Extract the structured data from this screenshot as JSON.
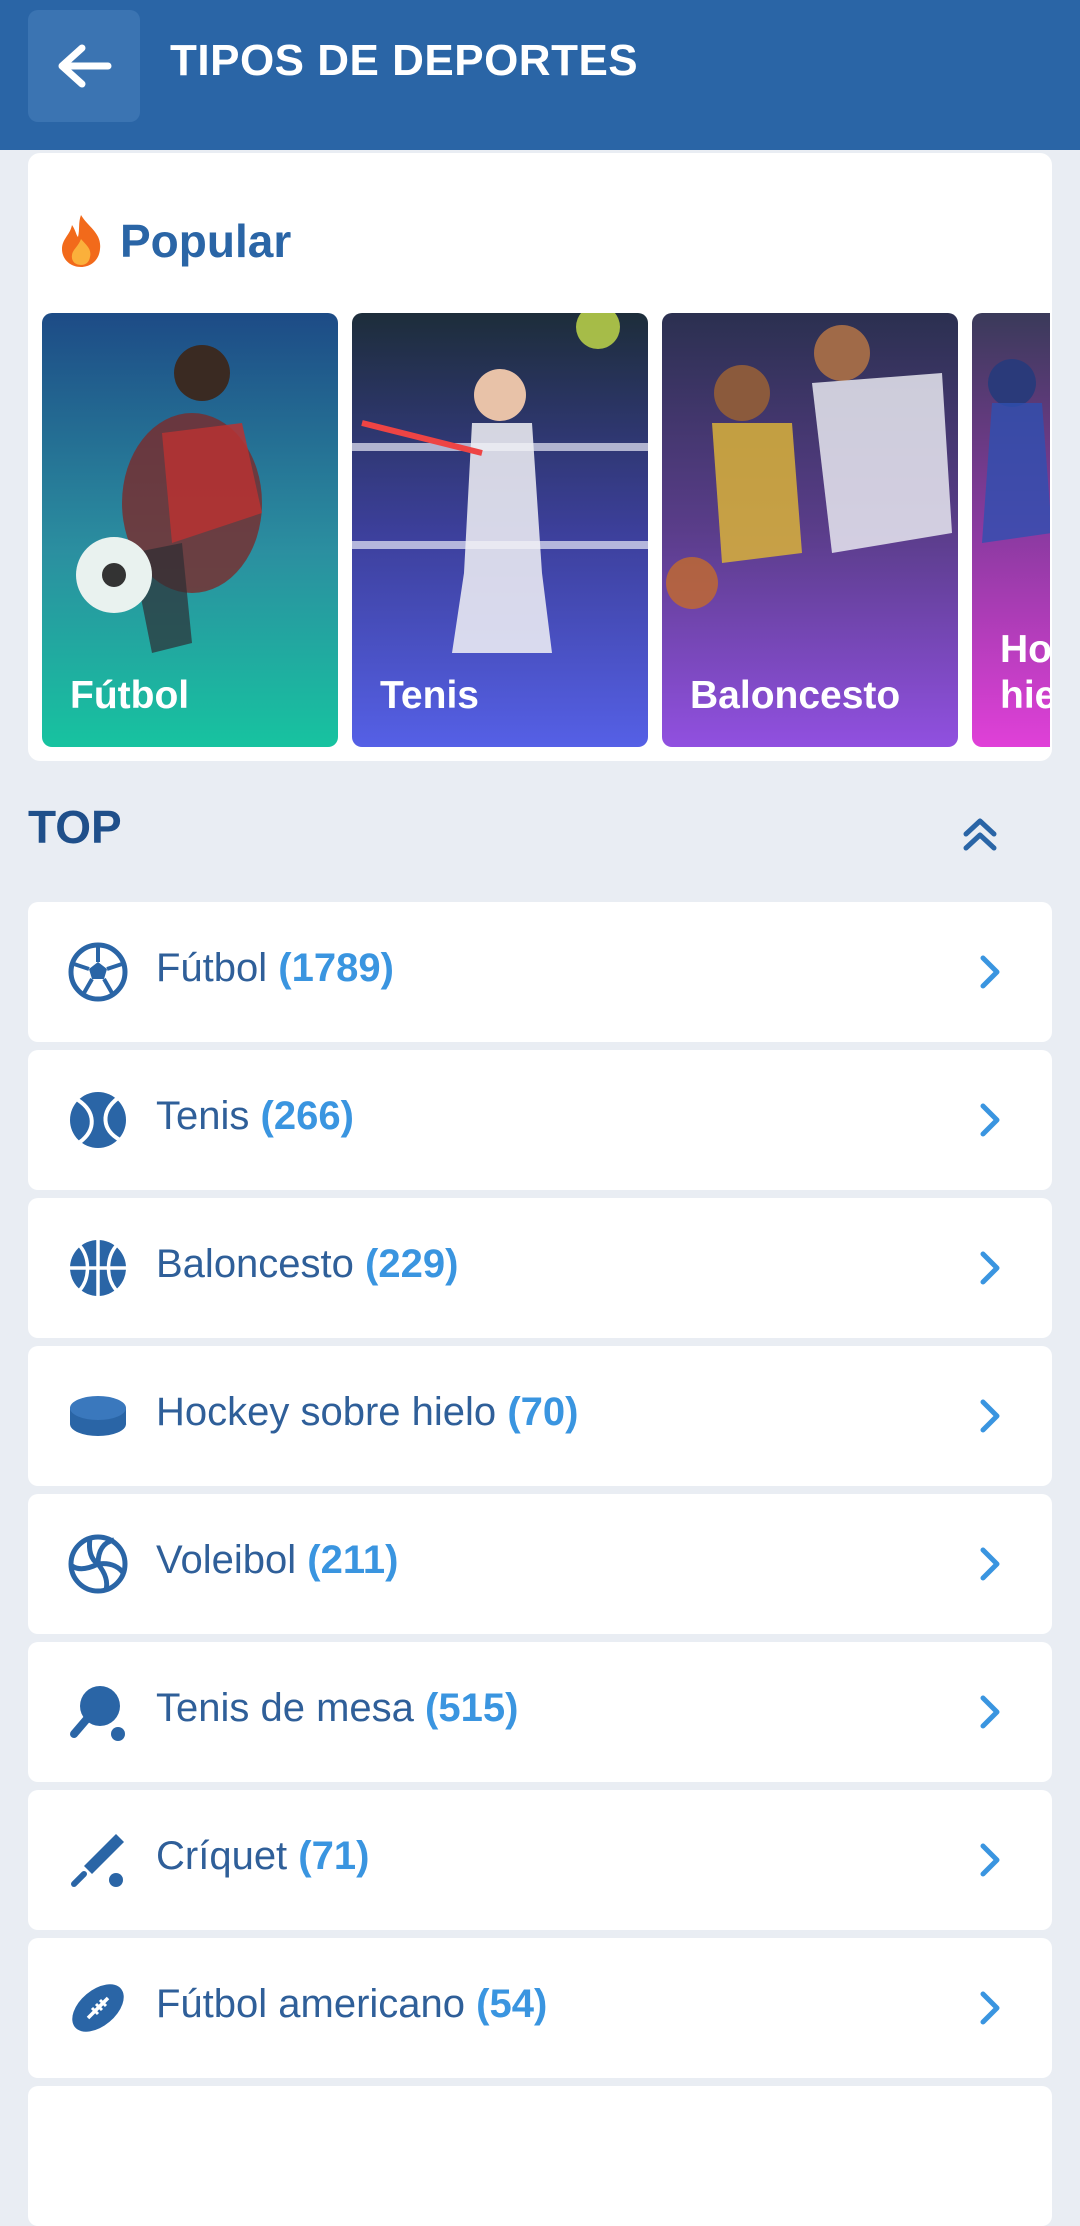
{
  "header": {
    "title": "TIPOS DE DEPORTES"
  },
  "popular": {
    "title": "Popular",
    "tiles": [
      {
        "label": "Fútbol"
      },
      {
        "label": "Tenis"
      },
      {
        "label": "Baloncesto"
      },
      {
        "label": "Hockey sobre hielo"
      }
    ]
  },
  "top": {
    "title": "TOP",
    "items": [
      {
        "name": "Fútbol",
        "count": "(1789)",
        "icon": "soccer-ball-icon"
      },
      {
        "name": "Tenis",
        "count": "(266)",
        "icon": "tennis-ball-icon"
      },
      {
        "name": "Baloncesto",
        "count": "(229)",
        "icon": "basketball-icon"
      },
      {
        "name": "Hockey sobre hielo",
        "count": "(70)",
        "icon": "hockey-puck-icon"
      },
      {
        "name": "Voleibol",
        "count": "(211)",
        "icon": "volleyball-icon"
      },
      {
        "name": "Tenis de mesa",
        "count": "(515)",
        "icon": "table-tennis-icon"
      },
      {
        "name": "Críquet",
        "count": "(71)",
        "icon": "cricket-icon"
      },
      {
        "name": "Fútbol americano",
        "count": "(54)",
        "icon": "american-football-icon"
      }
    ]
  },
  "colors": {
    "header": "#2a65a6",
    "accent": "#3a95e0",
    "text": "#2f5f99"
  }
}
